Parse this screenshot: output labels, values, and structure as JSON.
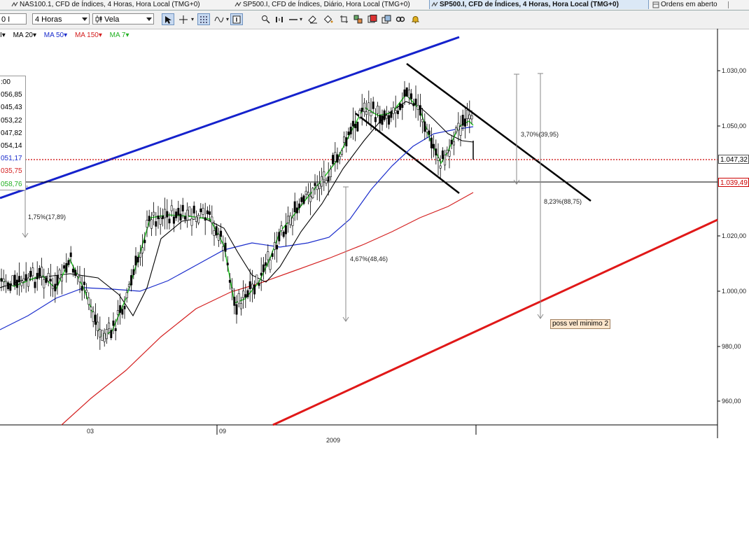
{
  "tabs": [
    {
      "label": "NAS100.1, CFD de Índices, 4 Horas, Hora Local (TMG+0)"
    },
    {
      "label": "SP500.I, CFD de Índices, Diário, Hora Local (TMG+0)"
    },
    {
      "label": "SP500.I, CFD de Índices, 4 Horas, Hora Local (TMG+0)"
    },
    {
      "label": "Ordens em aberto"
    }
  ],
  "toolbar": {
    "symbol": "0 I",
    "timeframe": "4 Horas",
    "chart_type": "Vela"
  },
  "ma_legend": [
    {
      "label": "I",
      "color": "#000000"
    },
    {
      "label": "MA 20",
      "color": "#000000"
    },
    {
      "label": "MA 50",
      "color": "#1a2ccc"
    },
    {
      "label": "MA 150",
      "color": "#d42020"
    },
    {
      "label": "MA 7",
      "color": "#22b022"
    }
  ],
  "data_window": [
    {
      "text": ":00",
      "color": "#000000"
    },
    {
      "text": "056,85",
      "color": "#000000"
    },
    {
      "text": "045,43",
      "color": "#000000"
    },
    {
      "text": "053,22",
      "color": "#000000"
    },
    {
      "text": "047,82",
      "color": "#000000"
    },
    {
      "text": "054,14",
      "color": "#000000"
    },
    {
      "text": "051,17",
      "color": "#1a2ccc"
    },
    {
      "text": "035,75",
      "color": "#d42020"
    },
    {
      "text": "058,76",
      "color": "#22b022"
    }
  ],
  "price_axis": {
    "ticks": [
      "1.030,00",
      "1.050,00",
      "1.020,00",
      "1.000,00",
      "980,00",
      "960,00"
    ]
  },
  "price_tags": {
    "current": "1.047,32",
    "line": "1.039,49"
  },
  "time_axis": {
    "ticks": [
      "03",
      "09"
    ],
    "year": "2009"
  },
  "annotations": {
    "pct1": "1,75%(17,89)",
    "pct2": "4,67%(48,46)",
    "pct3": "3,70%(39,95)",
    "pct4": "8,23%(88,75)",
    "note": "poss vel minimo 2"
  }
}
